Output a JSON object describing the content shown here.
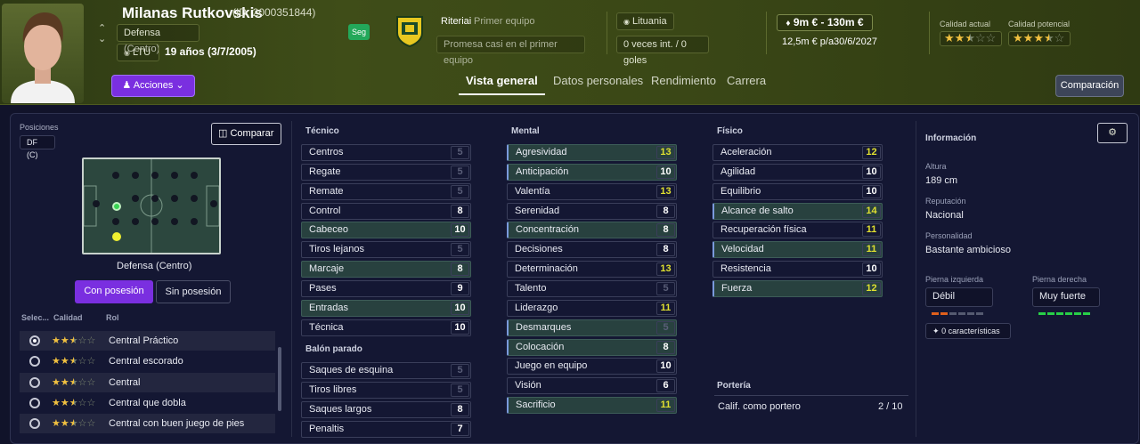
{
  "player": {
    "name": "Milanas Rutkovskis",
    "id": "(ID: 2000351844)",
    "position_full": "Defensa (Centro)",
    "nation_code": "LTU",
    "age": "19 años (3/7/2005)",
    "seg": "Seg",
    "actions": "Acciones"
  },
  "club": {
    "name": "Riteriai",
    "status": "Primer equipo",
    "squad_status": "Promesa casi en el primer equipo"
  },
  "nation": {
    "name": "Lituania",
    "caps": "0 veces int. / 0 goles"
  },
  "contract": {
    "value": "9m € - 130m €",
    "wage": "12,5m € p/a",
    "expiry": "30/6/2027"
  },
  "ratings": {
    "current_label": "Calidad actual",
    "potential_label": "Calidad potencial",
    "current_stars": 2.5,
    "potential_stars": 3.5
  },
  "tabs": [
    "Vista general",
    "Datos personales",
    "Rendimiento",
    "Carrera"
  ],
  "comparacion": "Comparación",
  "left": {
    "positions_label": "Posiciones",
    "position_badge": "DF (C)",
    "compare": "Comparar",
    "pitch_label": "Defensa (Centro)",
    "with_ball": "Con posesión",
    "without_ball": "Sin posesión",
    "col_select": "Selec...",
    "col_quality": "Calidad",
    "col_role": "Rol",
    "roles": [
      {
        "name": "Central Práctico",
        "stars": 2.5,
        "selected": true
      },
      {
        "name": "Central escorado",
        "stars": 2.5,
        "selected": false
      },
      {
        "name": "Central",
        "stars": 2.5,
        "selected": false
      },
      {
        "name": "Central que dobla",
        "stars": 2.5,
        "selected": false
      },
      {
        "name": "Central con buen juego de pies",
        "stars": 2.5,
        "selected": false
      }
    ]
  },
  "tecnico": {
    "title": "Técnico",
    "items": [
      {
        "n": "Centros",
        "v": "5",
        "c": "dim",
        "h": false
      },
      {
        "n": "Regate",
        "v": "5",
        "c": "dim",
        "h": false
      },
      {
        "n": "Remate",
        "v": "5",
        "c": "dim",
        "h": false
      },
      {
        "n": "Control",
        "v": "8",
        "c": "wh",
        "h": false
      },
      {
        "n": "Cabeceo",
        "v": "10",
        "c": "wh",
        "h": true
      },
      {
        "n": "Tiros lejanos",
        "v": "5",
        "c": "dim",
        "h": false
      },
      {
        "n": "Marcaje",
        "v": "8",
        "c": "wh",
        "h": true
      },
      {
        "n": "Pases",
        "v": "9",
        "c": "wh",
        "h": false
      },
      {
        "n": "Entradas",
        "v": "10",
        "c": "wh",
        "h": true
      },
      {
        "n": "Técnica",
        "v": "10",
        "c": "wh",
        "h": false
      }
    ]
  },
  "balon": {
    "title": "Balón parado",
    "items": [
      {
        "n": "Saques de esquina",
        "v": "5",
        "c": "dim",
        "h": false
      },
      {
        "n": "Tiros libres",
        "v": "5",
        "c": "dim",
        "h": false
      },
      {
        "n": "Saques largos",
        "v": "8",
        "c": "wh",
        "h": false
      },
      {
        "n": "Penaltis",
        "v": "7",
        "c": "wh",
        "h": false
      }
    ]
  },
  "mental": {
    "title": "Mental",
    "items": [
      {
        "n": "Agresividad",
        "v": "13",
        "c": "yl",
        "h": true
      },
      {
        "n": "Anticipación",
        "v": "10",
        "c": "wh",
        "h": true
      },
      {
        "n": "Valentía",
        "v": "13",
        "c": "yl",
        "h": false
      },
      {
        "n": "Serenidad",
        "v": "8",
        "c": "wh",
        "h": false
      },
      {
        "n": "Concentración",
        "v": "8",
        "c": "wh",
        "h": true
      },
      {
        "n": "Decisiones",
        "v": "8",
        "c": "wh",
        "h": false
      },
      {
        "n": "Determinación",
        "v": "13",
        "c": "yl",
        "h": false
      },
      {
        "n": "Talento",
        "v": "5",
        "c": "dim",
        "h": false
      },
      {
        "n": "Liderazgo",
        "v": "11",
        "c": "yl",
        "h": false
      },
      {
        "n": "Desmarques",
        "v": "5",
        "c": "dim",
        "h": true
      },
      {
        "n": "Colocación",
        "v": "8",
        "c": "wh",
        "h": true
      },
      {
        "n": "Juego en equipo",
        "v": "10",
        "c": "wh",
        "h": false
      },
      {
        "n": "Visión",
        "v": "6",
        "c": "wh",
        "h": false
      },
      {
        "n": "Sacrificio",
        "v": "11",
        "c": "yl",
        "h": true
      }
    ]
  },
  "fisico": {
    "title": "Físico",
    "items": [
      {
        "n": "Aceleración",
        "v": "12",
        "c": "yl",
        "h": false
      },
      {
        "n": "Agilidad",
        "v": "10",
        "c": "wh",
        "h": false
      },
      {
        "n": "Equilibrio",
        "v": "10",
        "c": "wh",
        "h": false
      },
      {
        "n": "Alcance de salto",
        "v": "14",
        "c": "yl",
        "h": true
      },
      {
        "n": "Recuperación física",
        "v": "11",
        "c": "yl",
        "h": false
      },
      {
        "n": "Velocidad",
        "v": "11",
        "c": "yl",
        "h": true
      },
      {
        "n": "Resistencia",
        "v": "10",
        "c": "wh",
        "h": false
      },
      {
        "n": "Fuerza",
        "v": "12",
        "c": "yl",
        "h": true
      }
    ]
  },
  "porteria": {
    "title": "Portería",
    "label": "Calif. como portero",
    "value": "2 / 10"
  },
  "info": {
    "title": "Información",
    "height_label": "Altura",
    "height": "189 cm",
    "rep_label": "Reputación",
    "rep": "Nacional",
    "pers_label": "Personalidad",
    "pers": "Bastante ambicioso",
    "left_label": "Pierna izquierda",
    "left": "Débil",
    "right_label": "Pierna derecha",
    "right": "Muy fuerte",
    "traits": "0 características"
  }
}
